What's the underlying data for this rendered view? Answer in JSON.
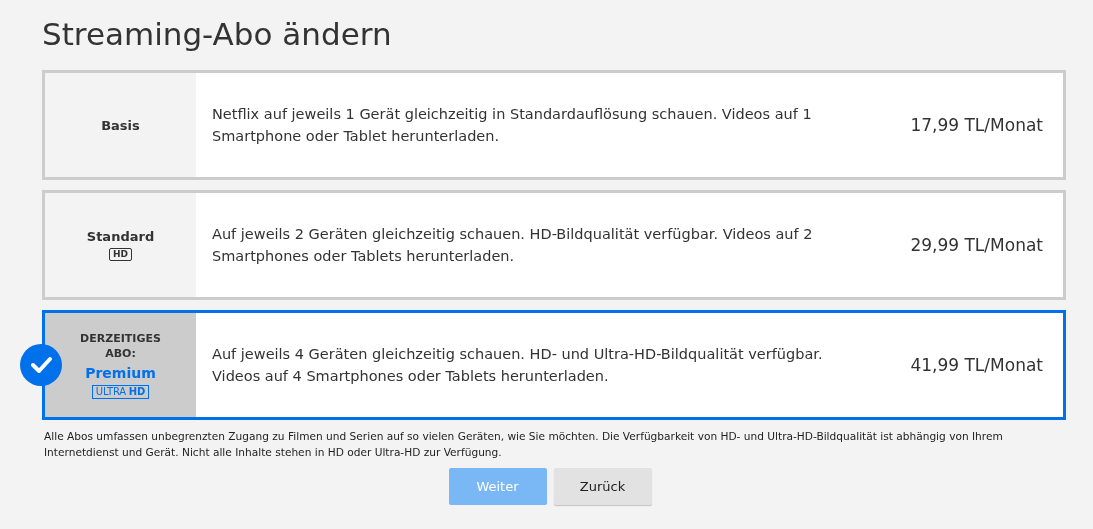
{
  "title": "Streaming-Abo ändern",
  "plans": [
    {
      "name": "Basis",
      "kind": "plain",
      "selected": false,
      "description": "Netflix auf jeweils 1 Gerät gleichzeitig in Standardauflösung schauen. Videos auf 1 Smartphone oder Tablet herunterladen.",
      "price": "17,99 TL/Monat"
    },
    {
      "name": "Standard",
      "kind": "hd",
      "badge": "HD",
      "selected": false,
      "description": "Auf jeweils 2 Geräten gleichzeitig schauen. HD-Bildqualität verfügbar. Videos auf 2 Smartphones oder Tablets herunterladen.",
      "price": "29,99 TL/Monat"
    },
    {
      "current_label": "DERZEITIGES ABO:",
      "name": "Premium",
      "kind": "uhd",
      "badge": "ULTRA **HD**",
      "selected": true,
      "description": "Auf jeweils 4 Geräten gleichzeitig schauen. HD- und Ultra-HD-Bildqualität verfügbar. Videos auf 4 Smartphones oder Tablets herunterladen.",
      "price": "41,99 TL/Monat"
    }
  ],
  "note": "Alle Abos umfassen unbegrenzten Zugang zu Filmen und Serien auf so vielen Geräten, wie Sie möchten. Die Verfügbarkeit von HD- und Ultra-HD-Bildqualität ist abhängig von Ihrem Internetdienst und Gerät. Nicht alle Inhalte stehen in HD oder Ultra-HD zur Verfügung.",
  "buttons": [
    {
      "label": "Weiter",
      "kind": "primary",
      "disabled": true
    },
    {
      "label": "Zurück",
      "kind": "secondary",
      "disabled": false
    }
  ]
}
